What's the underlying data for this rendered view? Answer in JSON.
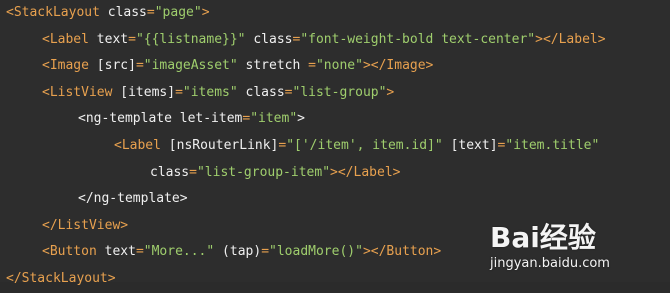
{
  "code_lines": [
    {
      "indent": 0,
      "parts": [
        [
          "tag",
          "<StackLayout "
        ],
        [
          "attr",
          "class"
        ],
        [
          "punc",
          "="
        ],
        [
          "str",
          "\"page\""
        ],
        [
          "tag",
          ">"
        ]
      ]
    },
    {
      "indent": 1,
      "parts": [
        [
          "tag",
          "<Label "
        ],
        [
          "attr",
          "text"
        ],
        [
          "punc",
          "="
        ],
        [
          "str",
          "\"{{listname}}\""
        ],
        [
          "plain",
          " "
        ],
        [
          "attr",
          "class"
        ],
        [
          "punc",
          "="
        ],
        [
          "str",
          "\"font-weight-bold text-center\""
        ],
        [
          "tag",
          "></Label>"
        ]
      ]
    },
    {
      "indent": 1,
      "parts": [
        [
          "tag",
          "<Image "
        ],
        [
          "attr",
          "[src]"
        ],
        [
          "punc",
          "="
        ],
        [
          "str",
          "\"imageAsset\""
        ],
        [
          "plain",
          " "
        ],
        [
          "attr",
          "stretch"
        ],
        [
          "plain",
          " "
        ],
        [
          "punc",
          "="
        ],
        [
          "str",
          "\"none\""
        ],
        [
          "tag",
          "></Image>"
        ]
      ]
    },
    {
      "indent": 1,
      "parts": [
        [
          "tag",
          "<ListView "
        ],
        [
          "attr",
          "[items]"
        ],
        [
          "punc",
          "="
        ],
        [
          "str",
          "\"items\""
        ],
        [
          "plain",
          " "
        ],
        [
          "attr",
          "class"
        ],
        [
          "punc",
          "="
        ],
        [
          "str",
          "\"list-group\""
        ],
        [
          "tag",
          ">"
        ]
      ]
    },
    {
      "indent": 2,
      "parts": [
        [
          "plain",
          "<ng-template "
        ],
        [
          "attr",
          "let-item"
        ],
        [
          "punc",
          "="
        ],
        [
          "str",
          "\"item\""
        ],
        [
          "plain",
          ">"
        ]
      ]
    },
    {
      "indent": 3,
      "parts": [
        [
          "tag",
          "<Label "
        ],
        [
          "attr",
          "[nsRouterLink]"
        ],
        [
          "punc",
          "="
        ],
        [
          "str",
          "\"['/item', item.id]\""
        ],
        [
          "plain",
          " "
        ],
        [
          "attr",
          "[text]"
        ],
        [
          "punc",
          "="
        ],
        [
          "str",
          "\"item.title\""
        ]
      ]
    },
    {
      "indent": 4,
      "parts": [
        [
          "attr",
          "class"
        ],
        [
          "punc",
          "="
        ],
        [
          "str",
          "\"list-group-item\""
        ],
        [
          "tag",
          "></Label>"
        ]
      ]
    },
    {
      "indent": 2,
      "parts": [
        [
          "plain",
          "</ng-template>"
        ]
      ]
    },
    {
      "indent": 1,
      "parts": [
        [
          "tag",
          "</ListView>"
        ]
      ]
    },
    {
      "indent": 1,
      "parts": [
        [
          "tag",
          "<Button "
        ],
        [
          "attr",
          "text"
        ],
        [
          "punc",
          "="
        ],
        [
          "str",
          "\"More...\""
        ],
        [
          "plain",
          " "
        ],
        [
          "attr",
          "(tap)"
        ],
        [
          "punc",
          "="
        ],
        [
          "str",
          "\"loadMore()\""
        ],
        [
          "tag",
          "></Button>"
        ]
      ]
    },
    {
      "indent": 0,
      "parts": [
        [
          "tag",
          "</StackLayout>"
        ]
      ]
    }
  ],
  "watermark": {
    "logo_text": "Bai经验",
    "url": "jingyan.baidu.com"
  },
  "colors": {
    "background": "#2d2d2d",
    "tag": "#e8a14f",
    "attribute": "#f0f0f0",
    "string": "#9fce6d"
  }
}
